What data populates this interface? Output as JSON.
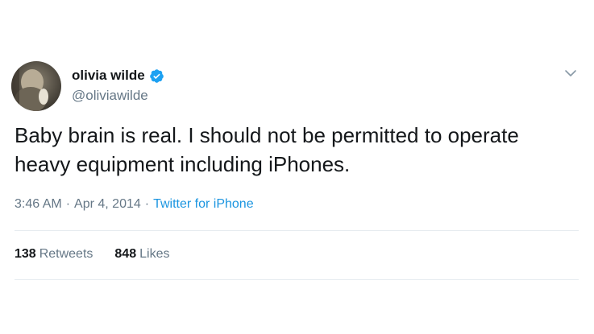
{
  "user": {
    "display_name": "olivia wilde",
    "handle": "@oliviawilde",
    "verified": true,
    "avatar_icon": "avatar-photo"
  },
  "tweet": {
    "text": "Baby brain is real. I should not be permitted to operate\nheavy equipment including iPhones.",
    "time": "3:46 AM",
    "separator": "·",
    "date": "Apr 4, 2014",
    "source": "Twitter for iPhone"
  },
  "stats": {
    "retweets_count": "138",
    "retweets_label": "Retweets",
    "likes_count": "848",
    "likes_label": "Likes"
  },
  "icons": {
    "verified": "verified-badge-icon",
    "menu": "chevron-down-icon"
  },
  "colors": {
    "text_primary": "#14171a",
    "text_secondary": "#657786",
    "link": "#1b95e0",
    "verified": "#1da1f2",
    "divider": "#e6ecf0"
  }
}
